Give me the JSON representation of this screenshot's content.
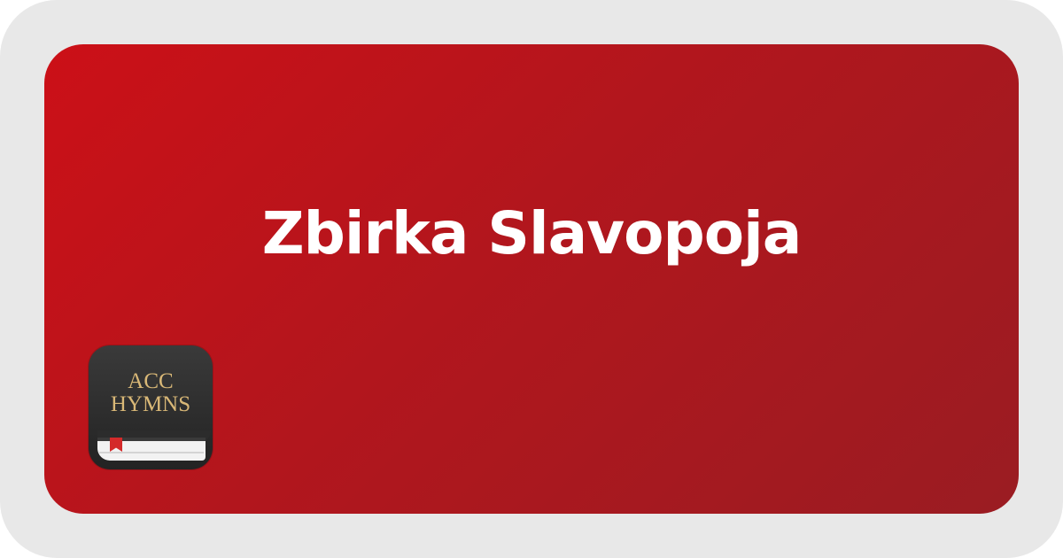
{
  "card": {
    "title": "Zbirka Slavopoja"
  },
  "app_icon": {
    "line1": "ACC",
    "line2": "HYMNS",
    "icon_name": "hymn-book-icon"
  },
  "colors": {
    "outer_frame": "#e8e8e8",
    "card_gradient_start": "#cc1017",
    "card_gradient_end": "#9a1c22",
    "title_text": "#ffffff",
    "icon_background": "#2a2a2a",
    "icon_text_gold": "#d9b877",
    "bookmark_red": "#d42a2a"
  }
}
